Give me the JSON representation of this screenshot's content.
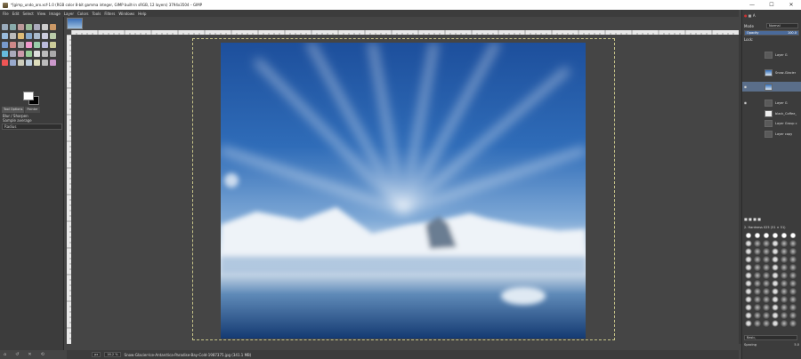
{
  "window": {
    "title": "*[gimp_undo_arx.xcf-1.0 (RGB color 8-bit gamma integer, GIMP built-in sRGB, 12 layers) 3794x3504 – GIMP",
    "minimize": "—",
    "maximize": "☐",
    "close": "✕"
  },
  "menu": [
    "File",
    "Edit",
    "Select",
    "View",
    "Image",
    "Layer",
    "Colors",
    "Tools",
    "Filters",
    "Windows",
    "Help"
  ],
  "tool_options": {
    "tabs": [
      "Tool Options",
      "Pointer"
    ],
    "title": "Blur / Sharpen",
    "sample": "Sample average",
    "radius_label": "Radius"
  },
  "statusbar": {
    "unit": "px",
    "zoom": "16.2 %",
    "filename": "Snow-Glacier-Ice-Antarctica-Paradise-Bay-Cold-1987375.jpg (341.1 MB)"
  },
  "layers_panel": {
    "mode_label": "Mode",
    "mode_value": "Normal",
    "opacity_label": "Opacity",
    "opacity_value": "100.0",
    "lock_label": "Lock:",
    "layers": [
      {
        "label": "Layer G",
        "visible": false
      },
      {
        "label": "Snow-Glacier",
        "visible": false
      },
      {
        "label": "",
        "visible": true,
        "selected": true
      },
      {
        "label": "Layer G",
        "visible": true
      },
      {
        "label": "black_Coffee_",
        "visible": false
      },
      {
        "label": "Layer Group c",
        "visible": false
      },
      {
        "label": "Layer copy",
        "visible": false
      }
    ]
  },
  "brushes_panel": {
    "header": "2. Hardness 025 (51 × 51)",
    "filter": "Basic,",
    "spacing_label": "Spacing",
    "spacing_value": "5.0"
  },
  "colors": {
    "accent": "#5a6e8a",
    "foreground": "#ffffff",
    "background": "#000000"
  }
}
